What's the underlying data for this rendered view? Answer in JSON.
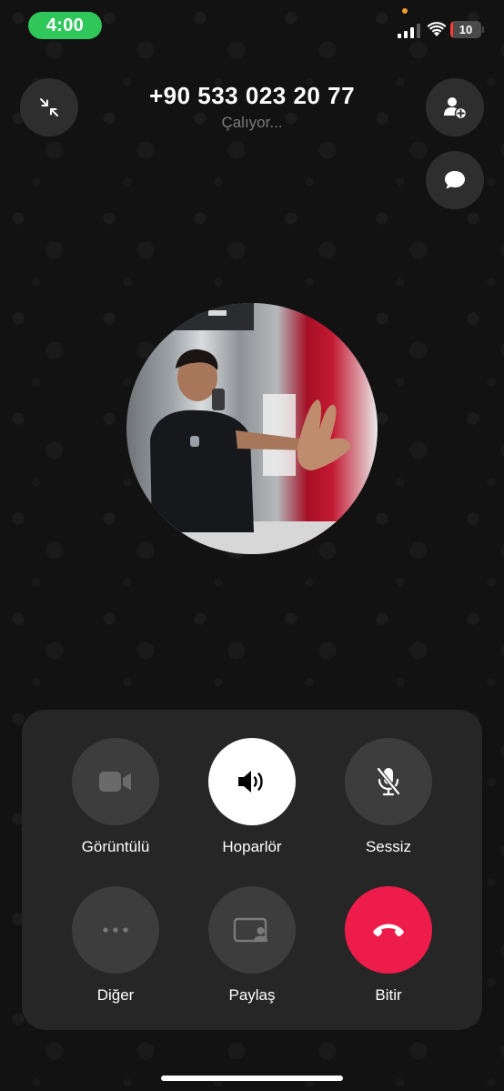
{
  "status_bar": {
    "time": "4:00",
    "battery_level": "10",
    "battery_fraction": 0.1,
    "time_pill_color": "#2fc65a",
    "battery_color": "#ff3b30",
    "icons": [
      "signal-icon",
      "wifi-icon",
      "battery-icon"
    ]
  },
  "call": {
    "number": "+90 533 023 20 77",
    "status": "Çalıyor..."
  },
  "header_icons": [
    "minimize-icon",
    "add-person-icon",
    "message-icon"
  ],
  "controls": {
    "video": {
      "label": "Görüntülü",
      "icon": "video-camera-icon"
    },
    "speaker": {
      "label": "Hoparlör",
      "icon": "speaker-icon",
      "active": true
    },
    "mute": {
      "label": "Sessiz",
      "icon": "mic-off-icon"
    },
    "more": {
      "label": "Diğer",
      "icon": "more-icon"
    },
    "share": {
      "label": "Paylaş",
      "icon": "screen-share-icon"
    },
    "end": {
      "label": "Bitir",
      "icon": "end-call-icon",
      "color": "#ee1c4a"
    }
  }
}
